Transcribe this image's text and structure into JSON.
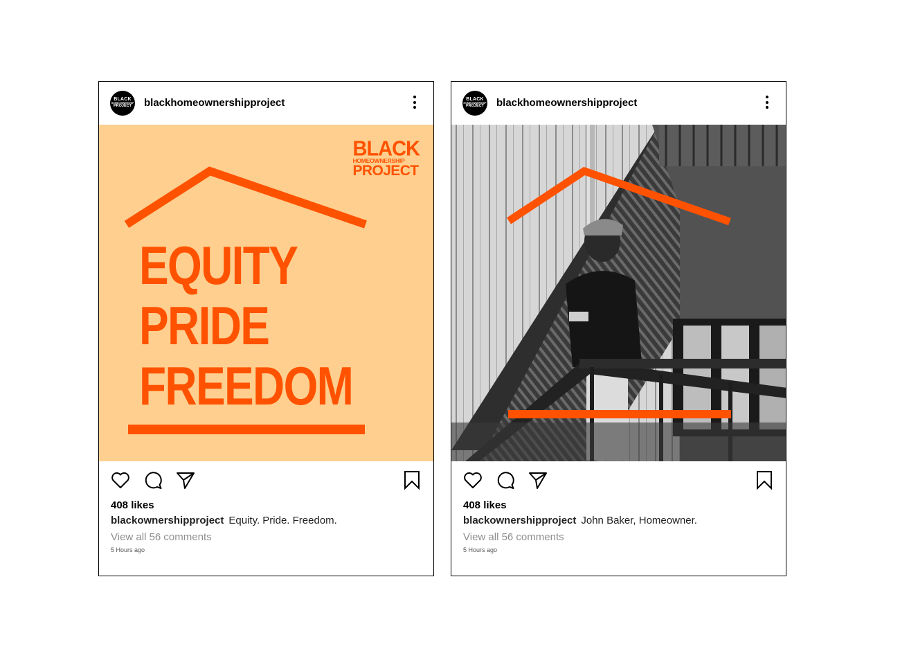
{
  "colors": {
    "accent": "#ff5200",
    "peach_background": "#fecf8f",
    "text": "#000000",
    "muted_text": "#8e8e8e"
  },
  "posts": [
    {
      "username": "blackhomeownershipproject",
      "avatar_text": [
        "BLACK",
        "HOMEOWNERSHIP",
        "PROJECT"
      ],
      "media": {
        "type": "graphic",
        "logo": [
          "BLACK",
          "HOMEOWNERSHIP",
          "PROJECT"
        ],
        "headline": [
          "EQUITY",
          "PRIDE",
          "FREEDOM"
        ]
      },
      "icons": [
        "more-vertical-icon",
        "heart-icon",
        "comment-icon",
        "send-icon",
        "bookmark-icon"
      ],
      "likes": "408 likes",
      "caption_user": "blackownershipproject",
      "caption_text": "Equity. Pride. Freedom.",
      "comments_link": "View all 56 comments",
      "timestamp": "5 Hours ago"
    },
    {
      "username": "blackhomeownershipproject",
      "avatar_text": [
        "BLACK",
        "HOMEOWNERSHIP",
        "PROJECT"
      ],
      "media": {
        "type": "photo",
        "description_icon": "a-frame-cabin-photo"
      },
      "icons": [
        "more-vertical-icon",
        "heart-icon",
        "comment-icon",
        "send-icon",
        "bookmark-icon"
      ],
      "likes": "408 likes",
      "caption_user": "blackownershipproject",
      "caption_text": "John Baker, Homeowner.",
      "comments_link": "View all 56 comments",
      "timestamp": "5 Hours ago"
    }
  ]
}
